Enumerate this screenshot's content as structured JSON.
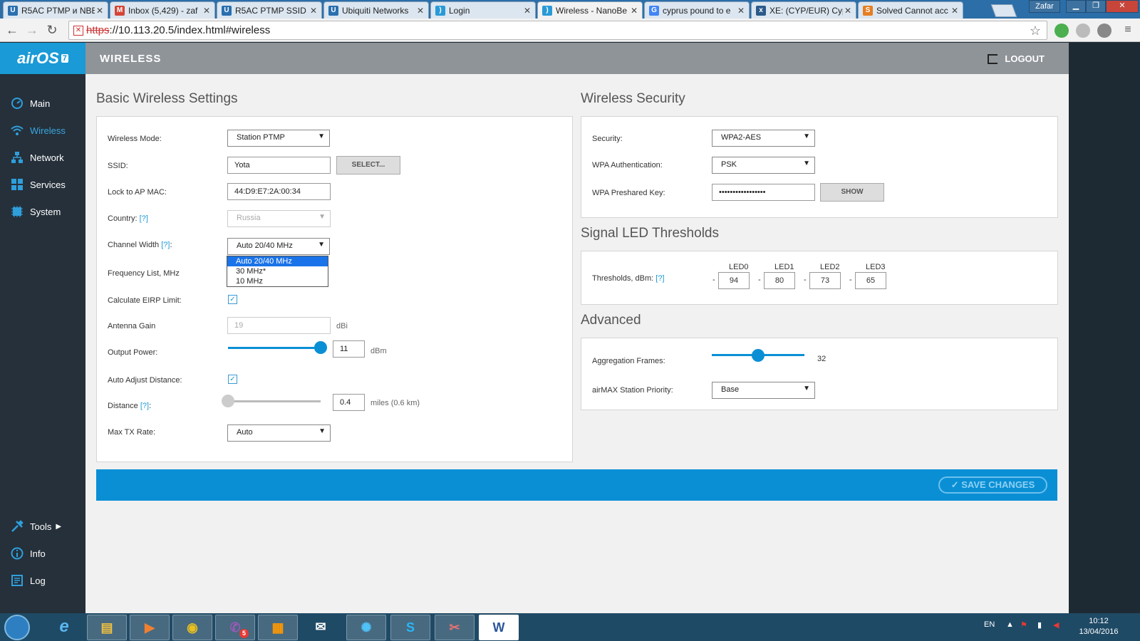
{
  "browser": {
    "tabs": [
      {
        "label": "R5AC PTMP и NBE",
        "icon": "ubiquiti-icon",
        "color": "#2a6fb0"
      },
      {
        "label": "Inbox (5,429) - zaf",
        "icon": "gmail-icon",
        "color": "#d44638"
      },
      {
        "label": "R5AC PTMP SSID",
        "icon": "ubiquiti-icon",
        "color": "#2a6fb0"
      },
      {
        "label": "Ubiquiti Networks",
        "icon": "ubiquiti-icon",
        "color": "#2a6fb0"
      },
      {
        "label": "Login",
        "icon": "wifi-icon",
        "color": "#2a9ad6"
      },
      {
        "label": "Wireless - NanoBe",
        "icon": "wifi-icon",
        "color": "#2a9ad6"
      },
      {
        "label": "cyprus pound to e",
        "icon": "google-icon",
        "color": "#4285f4"
      },
      {
        "label": "XE: (CYP/EUR) Cyp",
        "icon": "xe-icon",
        "color": "#2b5a8a"
      },
      {
        "label": "Solved Cannot acc",
        "icon": "community-icon",
        "color": "#e67e22"
      }
    ],
    "user": "Zafar",
    "url_scheme": "https",
    "url_rest": "://10.113.20.5/index.html#wireless"
  },
  "brand": {
    "name": "airOS",
    "version": "7"
  },
  "sidebar": {
    "items": [
      {
        "label": "Main",
        "icon": "dashboard-icon"
      },
      {
        "label": "Wireless",
        "icon": "wifi-icon"
      },
      {
        "label": "Network",
        "icon": "network-icon"
      },
      {
        "label": "Services",
        "icon": "services-icon"
      },
      {
        "label": "System",
        "icon": "system-icon"
      }
    ],
    "bottom": [
      {
        "label": "Tools",
        "icon": "tools-icon"
      },
      {
        "label": "Info",
        "icon": "info-icon"
      },
      {
        "label": "Log",
        "icon": "log-icon"
      }
    ]
  },
  "header": {
    "title": "WIRELESS",
    "logout": "LOGOUT"
  },
  "basic": {
    "title": "Basic Wireless Settings",
    "wireless_mode_label": "Wireless Mode:",
    "wireless_mode": "Station PTMP",
    "ssid_label": "SSID:",
    "ssid": "Yota",
    "select_btn": "SELECT...",
    "lock_mac_label": "Lock to AP MAC:",
    "lock_mac": "44:D9:E7:2A:00:34",
    "country_label": "Country:",
    "help": "[?]",
    "country": "Russia",
    "channel_width_label": "Channel Width",
    "channel_width": "Auto 20/40 MHz",
    "channel_options": [
      "Auto 20/40 MHz",
      "30 MHz*",
      "10 MHz"
    ],
    "freq_label": "Frequency List, MHz",
    "eirp_label": "Calculate EIRP Limit:",
    "antenna_label": "Antenna Gain",
    "antenna_gain": "19",
    "antenna_unit": "dBi",
    "output_label": "Output Power:",
    "output_power": "11",
    "output_unit": "dBm",
    "output_level": 1.0,
    "auto_distance_label": "Auto Adjust Distance:",
    "distance_label": "Distance",
    "distance": "0.4",
    "distance_unit": "miles (0.6 km)",
    "distance_level": 0.0,
    "max_tx_label": "Max TX Rate:",
    "max_tx": "Auto"
  },
  "security": {
    "title": "Wireless Security",
    "security_label": "Security:",
    "security": "WPA2-AES",
    "auth_label": "WPA Authentication:",
    "auth": "PSK",
    "psk_label": "WPA Preshared Key:",
    "psk": "•••••••••••••••••",
    "show_btn": "SHOW"
  },
  "led": {
    "title": "Signal LED Thresholds",
    "label": "Thresholds, dBm:",
    "help": "[?]",
    "leds": [
      {
        "name": "LED0",
        "value": "94"
      },
      {
        "name": "LED1",
        "value": "80"
      },
      {
        "name": "LED2",
        "value": "73"
      },
      {
        "name": "LED3",
        "value": "65"
      }
    ]
  },
  "advanced": {
    "title": "Advanced",
    "agg_label": "Aggregation Frames:",
    "agg_value": "32",
    "agg_level": 0.5,
    "priority_label": "airMAX Station Priority:",
    "priority": "Base"
  },
  "save_label": "SAVE CHANGES",
  "colors": {
    "accent": "#1a9ad6",
    "sidebar": "#25303a",
    "header": "#8f9499"
  },
  "taskbar": {
    "lang": "EN",
    "time": "10:12",
    "date": "13/04/2016",
    "badge": "5"
  }
}
